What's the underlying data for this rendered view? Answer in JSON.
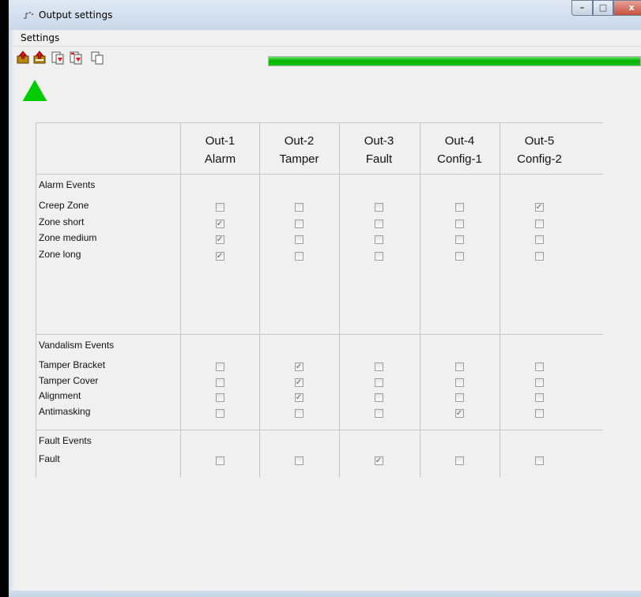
{
  "window": {
    "title": "Output settings",
    "close_glyph": "x",
    "max_glyph": "□",
    "min_glyph": "–"
  },
  "menu": [
    "Settings"
  ],
  "toolbar": [
    {
      "icon": "export-icon"
    },
    {
      "icon": "export-all-icon"
    },
    {
      "icon": "import-icon"
    },
    {
      "icon": "import-all-icon"
    },
    {
      "icon": "copy-icon"
    }
  ],
  "progress": {
    "value": 1.0,
    "color": "#12bb12"
  },
  "status": {
    "icon": "green-triangle-icon",
    "color": "#00cc00"
  },
  "columns": [
    {
      "line1": "Out-1",
      "line2": "Alarm"
    },
    {
      "line1": "Out-2",
      "line2": "Tamper"
    },
    {
      "line1": "Out-3",
      "line2": "Fault"
    },
    {
      "line1": "Out-4",
      "line2": "Config-1"
    },
    {
      "line1": "Out-5",
      "line2": "Config-2"
    }
  ],
  "sections": [
    {
      "title": "Alarm Events",
      "rows": [
        {
          "label": "Creep Zone",
          "checks": [
            false,
            false,
            false,
            false,
            true
          ]
        },
        {
          "label": "Zone short",
          "checks": [
            true,
            false,
            false,
            false,
            false
          ]
        },
        {
          "label": "Zone medium",
          "checks": [
            true,
            false,
            false,
            false,
            false
          ]
        },
        {
          "label": "Zone long",
          "checks": [
            true,
            false,
            false,
            false,
            false
          ]
        }
      ]
    },
    {
      "title": "Vandalism Events",
      "rows": [
        {
          "label": "Tamper Bracket",
          "checks": [
            false,
            true,
            false,
            false,
            false
          ]
        },
        {
          "label": "Tamper Cover",
          "checks": [
            false,
            true,
            false,
            false,
            false
          ]
        },
        {
          "label": "Alignment",
          "checks": [
            false,
            true,
            false,
            false,
            false
          ]
        },
        {
          "label": "Antimasking",
          "checks": [
            false,
            false,
            false,
            true,
            false
          ]
        }
      ]
    },
    {
      "title": "Fault Events",
      "rows": [
        {
          "label": "Fault",
          "checks": [
            false,
            false,
            true,
            false,
            false
          ]
        }
      ]
    }
  ],
  "check_glyph": "✓"
}
